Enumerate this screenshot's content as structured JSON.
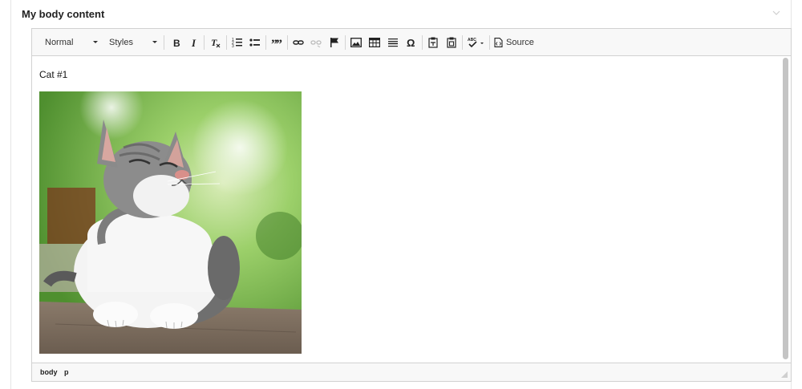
{
  "field": {
    "label": "My body content"
  },
  "toolbar": {
    "format_combo": "Normal",
    "styles_combo": "Styles",
    "source_label": "Source",
    "icons": [
      "bold-icon",
      "italic-icon",
      "remove-format-icon",
      "numbered-list-icon",
      "bulleted-list-icon",
      "blockquote-icon",
      "link-icon",
      "unlink-icon",
      "anchor-icon",
      "image-icon",
      "table-icon",
      "horizontal-rule-icon",
      "special-char-icon",
      "paste-text-icon",
      "paste-word-icon",
      "spellcheck-icon",
      "source-icon"
    ]
  },
  "content": {
    "paragraph": "Cat #1"
  },
  "pathbar": {
    "elements": [
      "body",
      "p"
    ]
  }
}
